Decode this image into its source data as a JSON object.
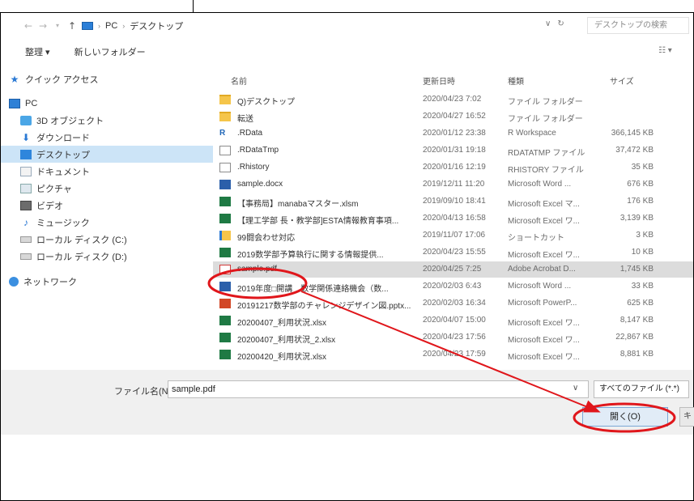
{
  "address_bar": {
    "back_icon": "←",
    "forward_icon": "→",
    "recent_icon": "▾",
    "up_icon": "↑",
    "path": [
      "PC",
      "デスクトップ"
    ],
    "sep": "›",
    "dropdown_icon": "∨",
    "refresh_icon": "↻",
    "search_placeholder": "デスクトップの検索"
  },
  "toolbar": {
    "organize": "整理 ▾",
    "new_folder": "新しいフォルダー",
    "view_icon": "☷ ▾"
  },
  "nav_pane": {
    "items": [
      {
        "label": "クイック アクセス",
        "icon": "star-icon"
      },
      {
        "label": "PC",
        "icon": "pc-icon"
      },
      {
        "label": "3D オブジェクト",
        "icon": "3d-objects-icon"
      },
      {
        "label": "ダウンロード",
        "icon": "download-icon"
      },
      {
        "label": "デスクトップ",
        "icon": "desktop-icon",
        "selected": true
      },
      {
        "label": "ドキュメント",
        "icon": "documents-icon"
      },
      {
        "label": "ピクチャ",
        "icon": "pictures-icon"
      },
      {
        "label": "ビデオ",
        "icon": "videos-icon"
      },
      {
        "label": "ミュージック",
        "icon": "music-icon"
      },
      {
        "label": "ローカル ディスク (C:)",
        "icon": "drive-icon"
      },
      {
        "label": "ローカル ディスク (D:)",
        "icon": "drive-icon"
      },
      {
        "label": "ネットワーク",
        "icon": "network-icon"
      }
    ]
  },
  "columns": {
    "name": "名前",
    "date": "更新日時",
    "type": "種類",
    "size": "サイズ"
  },
  "files": [
    {
      "name": "Q)デスクトップ",
      "date": "2020/04/23 7:02",
      "type": "ファイル フォルダー",
      "size": "",
      "icon": "folder-icon"
    },
    {
      "name": "転送",
      "date": "2020/04/27 16:52",
      "type": "ファイル フォルダー",
      "size": "",
      "icon": "folder-icon"
    },
    {
      "name": ".RData",
      "date": "2020/01/12 23:38",
      "type": "R Workspace",
      "size": "366,145 KB",
      "icon": "r-icon"
    },
    {
      "name": ".RDataTmp",
      "date": "2020/01/31 19:18",
      "type": "RDATATMP ファイル",
      "size": "37,472 KB",
      "icon": "file-icon"
    },
    {
      "name": ".Rhistory",
      "date": "2020/01/16 12:19",
      "type": "RHISTORY ファイル",
      "size": "35 KB",
      "icon": "file-icon"
    },
    {
      "name": "sample.docx",
      "date": "2019/12/11 11:20",
      "type": "Microsoft Word ...",
      "size": "676 KB",
      "icon": "word-icon"
    },
    {
      "name": "【事務局】manabaマスター.xlsm",
      "date": "2019/09/10 18:41",
      "type": "Microsoft Excel マ...",
      "size": "176 KB",
      "icon": "excel-icon"
    },
    {
      "name": "【理工学部 長・教学部]ESTA情報教育事項...",
      "date": "2020/04/13 16:58",
      "type": "Microsoft Excel ワ...",
      "size": "3,139 KB",
      "icon": "excel-icon"
    },
    {
      "name": "99闘会わせ対応",
      "date": "2019/11/07 17:06",
      "type": "ショートカット",
      "size": "3 KB",
      "icon": "shortcut-icon"
    },
    {
      "name": "2019数学部予算執行に関する情報提供...",
      "date": "2020/04/23 15:55",
      "type": "Microsoft Excel ワ...",
      "size": "10 KB",
      "icon": "excel-icon"
    },
    {
      "name": "sample.pdf",
      "date": "2020/04/25 7:25",
      "type": "Adobe Acrobat D...",
      "size": "1,745 KB",
      "icon": "pdf-icon",
      "selected": true
    },
    {
      "name": "2019年度□開講　数学関係連絡機会（数...",
      "date": "2020/02/03 6:43",
      "type": "Microsoft Word ...",
      "size": "33 KB",
      "icon": "word-icon"
    },
    {
      "name": "20191217数学部のチャレンジデザイン図.pptx...",
      "date": "2020/02/03 16:34",
      "type": "Microsoft PowerP...",
      "size": "625 KB",
      "icon": "ppt-icon"
    },
    {
      "name": "20200407_利用状況.xlsx",
      "date": "2020/04/07 15:00",
      "type": "Microsoft Excel ワ...",
      "size": "8,147 KB",
      "icon": "excel-icon"
    },
    {
      "name": "20200407_利用状況_2.xlsx",
      "date": "2020/04/23 17:56",
      "type": "Microsoft Excel ワ...",
      "size": "22,867 KB",
      "icon": "excel-icon"
    },
    {
      "name": "20200420_利用状況.xlsx",
      "date": "2020/04/23 17:59",
      "type": "Microsoft Excel ワ...",
      "size": "8,881 KB",
      "icon": "excel-icon"
    }
  ],
  "footer": {
    "filename_label": "ファイル名(N):",
    "filename_value": "sample.pdf",
    "filename_dd": "∨",
    "filetype": "すべてのファイル (*.*)",
    "open_button": "開く(O)",
    "cancel_stub": "キ"
  },
  "annotation_color": "#e0161b"
}
